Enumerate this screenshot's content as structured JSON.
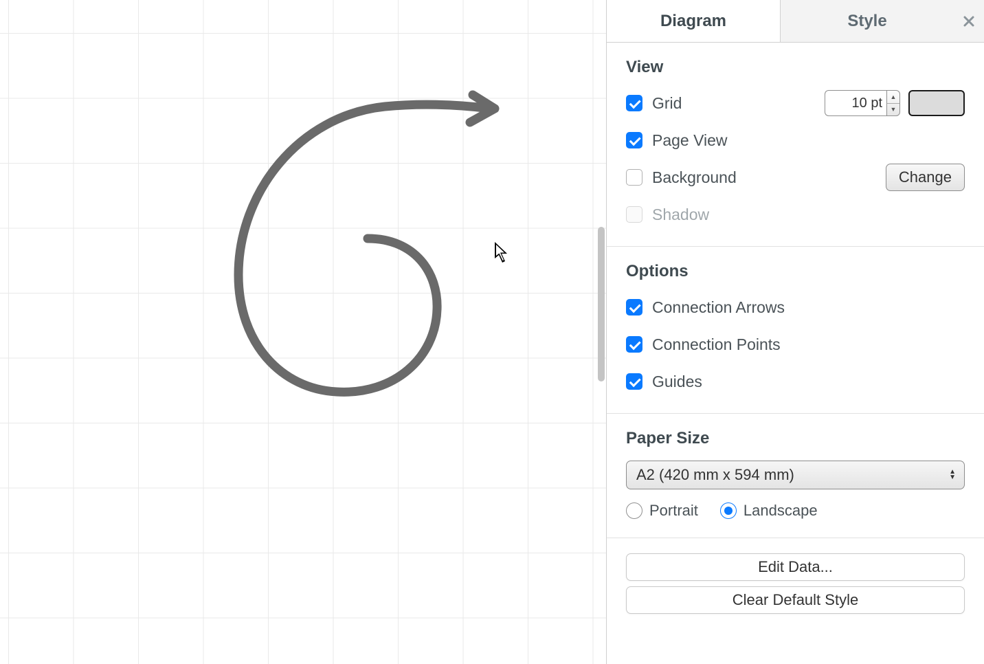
{
  "tabs": {
    "diagram": "Diagram",
    "style": "Style"
  },
  "sections": {
    "view_title": "View",
    "options_title": "Options",
    "paper_title": "Paper Size"
  },
  "view": {
    "grid_label": "Grid",
    "grid_value": "10 pt",
    "page_view_label": "Page View",
    "background_label": "Background",
    "change_button": "Change",
    "shadow_label": "Shadow"
  },
  "options": {
    "conn_arrows": "Connection Arrows",
    "conn_points": "Connection Points",
    "guides": "Guides"
  },
  "paper": {
    "size_selected": "A2 (420 mm x 594 mm)",
    "portrait": "Portrait",
    "landscape": "Landscape"
  },
  "buttons": {
    "edit_data": "Edit Data...",
    "clear_style": "Clear Default Style"
  }
}
